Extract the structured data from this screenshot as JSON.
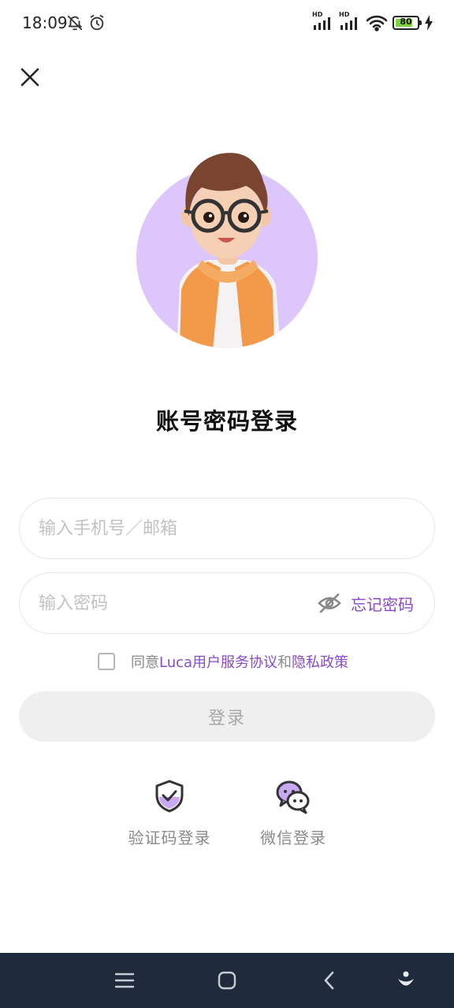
{
  "status_bar": {
    "time": "18:09",
    "icons_left": [
      "bell-off-icon",
      "alarm-icon"
    ],
    "icons_right": [
      "signal-hd-icon",
      "signal-hd-icon",
      "wifi-icon",
      "battery-icon",
      "charging-icon"
    ],
    "sim1_label": "HD",
    "sim2_label": "HD",
    "battery_level": "80"
  },
  "header": {
    "close_icon": "close-icon"
  },
  "avatar": {
    "circle_color": "#dcc6fb"
  },
  "page": {
    "title": "账号密码登录"
  },
  "form": {
    "account_placeholder": "输入手机号／邮箱",
    "password_placeholder": "输入密码",
    "forgot_password": "忘记密码",
    "agree_prefix": "同意",
    "terms_link": "Luca用户服务协议",
    "agree_and": "和",
    "privacy_link": "隐私政策",
    "login_button": "登录"
  },
  "alt_login": [
    {
      "label": "验证码登录",
      "icon": "shield-check-icon"
    },
    {
      "label": "微信登录",
      "icon": "wechat-icon"
    }
  ],
  "nav_bar": {
    "buttons": [
      "menu-icon",
      "home-icon",
      "back-icon",
      "assistant-icon"
    ]
  },
  "colors": {
    "accent": "#8a49c9",
    "accent_light": "#c8a8f0",
    "button_disabled": "#efefef",
    "nav_bg": "#1f2a3c"
  }
}
